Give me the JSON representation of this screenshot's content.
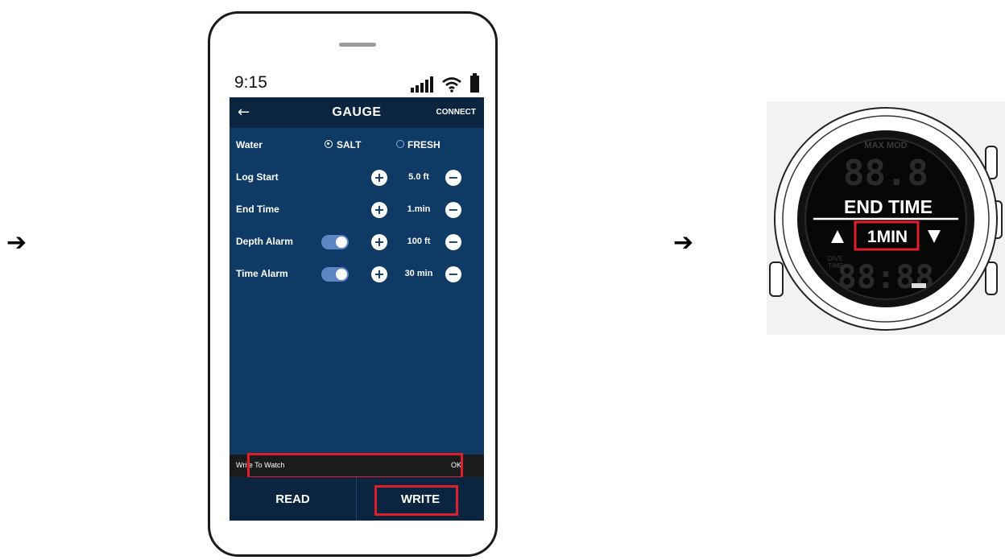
{
  "status": {
    "time": "9:15"
  },
  "nav": {
    "title": "GAUGE",
    "connect": "CONNECT"
  },
  "water": {
    "label": "Water",
    "salt": "SALT",
    "fresh": "FRESH"
  },
  "settings": [
    {
      "label": "Log Start",
      "value": "5.0 ft",
      "toggle": false
    },
    {
      "label": "End Time",
      "value": "1.min",
      "toggle": false
    },
    {
      "label": "Depth Alarm",
      "value": "100 ft",
      "toggle": true
    },
    {
      "label": "Time Alarm",
      "value": "30 min",
      "toggle": true
    }
  ],
  "write_bar": {
    "text": "Write To Watch",
    "ok": "OK"
  },
  "buttons": {
    "read": "READ",
    "write": "WRITE"
  },
  "watch": {
    "heading": "END TIME",
    "value": "1MIN"
  },
  "colors": {
    "screen_bg": "#0f3a66",
    "bar_bg": "#0b2440",
    "highlight": "#e01e2c",
    "toggle_on": "#5e86c4"
  }
}
